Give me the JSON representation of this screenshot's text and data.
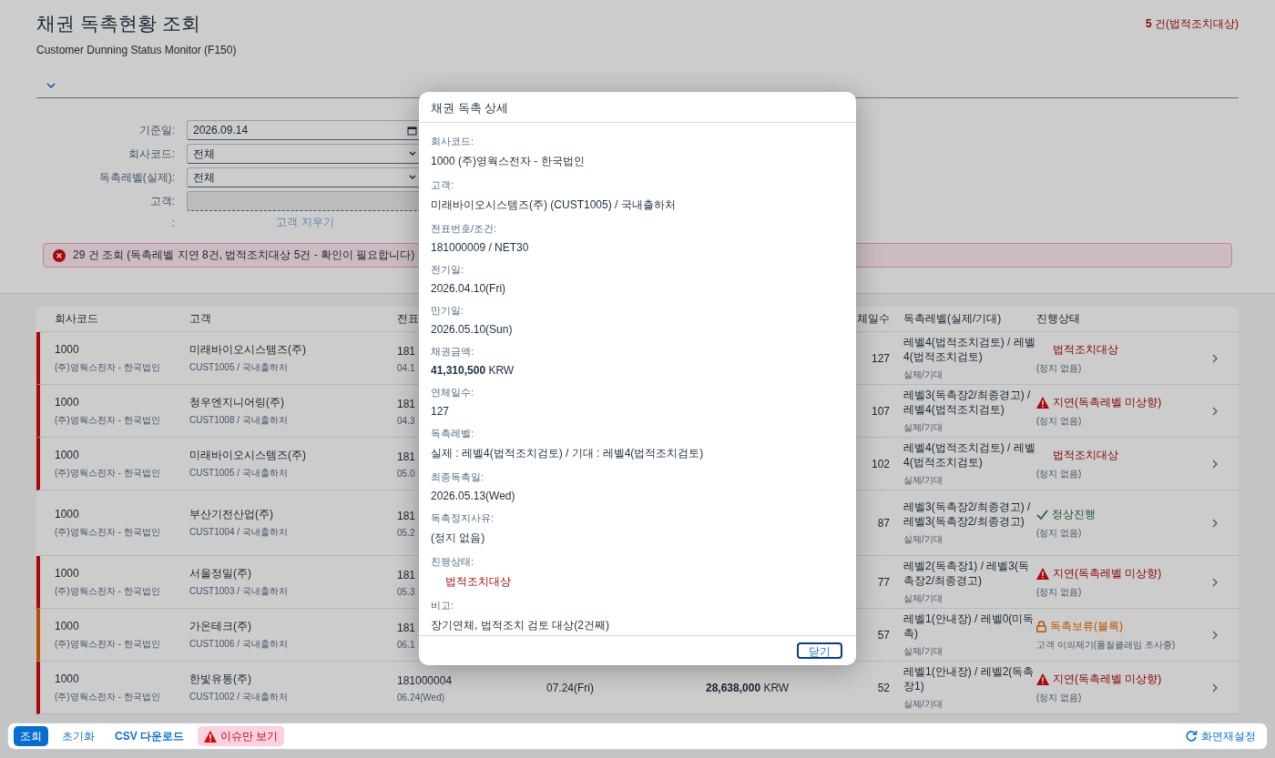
{
  "page": {
    "title": "채권 독촉현황 조회",
    "subtitle": "Customer Dunning Status Monitor (F150)",
    "legal_count": "**5** 건(법적조치대상)"
  },
  "filters": [
    {
      "label": "기준일:",
      "kind": "date",
      "value": "2026.09.14"
    },
    {
      "label": "회사코드:",
      "kind": "select",
      "value": "전체"
    },
    {
      "label": "독촉레벨(실제):",
      "kind": "select",
      "value": "전체"
    },
    {
      "label": "고객:",
      "kind": "text",
      "disabled": true
    },
    {
      "label": ":",
      "kind": "link",
      "value": "고객 지우기"
    }
  ],
  "message": {
    "text": "29 건 조회 (독촉레벨 지연 8건, 법적조치대상 5건 - 확인이 필요합니다)"
  },
  "table": {
    "headers": {
      "company": "회사코드",
      "customer": "고객",
      "document": "전표",
      "days": "체일수",
      "level": "독촉레벨(실제/기대)",
      "status": "진행상태"
    },
    "rows": [
      {
        "kind": "legal",
        "company": "1000",
        "company_name": "(주)영웍스전자 - 한국법인",
        "customer": "미래바이오시스템즈(주)",
        "customer_sub": "CUST1005 / 국내출하처",
        "document": "181",
        "doc_date": "04.1",
        "days": "127",
        "level": "레벨4(법적조치검토) / 레벨4(법적조치검토)",
        "level_sub": "실제/기대",
        "status": "법적조치대상",
        "status_note": "(정지 없음)"
      },
      {
        "kind": "delay",
        "company": "1000",
        "company_name": "(주)영웍스전자 - 한국법인",
        "customer": "청우엔지니어링(주)",
        "customer_sub": "CUST1008 / 국내출하처",
        "document": "181",
        "doc_date": "04.3",
        "days": "107",
        "level": "레벨3(독촉장2/최종경고) / 레벨4(법적조치검토)",
        "level_sub": "실제/기대",
        "status": "지연(독촉레벨 미상향)",
        "status_note": "(정지 없음)"
      },
      {
        "kind": "legal",
        "company": "1000",
        "company_name": "(주)영웍스전자 - 한국법인",
        "customer": "미래바이오시스템즈(주)",
        "customer_sub": "CUST1005 / 국내출하처",
        "document": "181",
        "doc_date": "05.0",
        "days": "102",
        "level": "레벨4(법적조치검토) / 레벨4(법적조치검토)",
        "level_sub": "실제/기대",
        "status": "법적조치대상",
        "status_note": "(정지 없음)"
      },
      {
        "kind": "normal",
        "company": "1000",
        "company_name": "(주)영웍스전자 - 한국법인",
        "customer": "부산기전산업(주)",
        "customer_sub": "CUST1004 / 국내출하처",
        "document": "181",
        "doc_date": "05.2",
        "days": "87",
        "level": "레벨3(독촉장2/최종경고) / 레벨3(독촉장2/최종경고)",
        "level_sub": "실제/기대",
        "status": "정상진행",
        "status_note": "(정지 없음)"
      },
      {
        "kind": "delay",
        "company": "1000",
        "company_name": "(주)영웍스전자 - 한국법인",
        "customer": "서울정밀(주)",
        "customer_sub": "CUST1003 / 국내출하처",
        "document": "181",
        "doc_date": "05.3",
        "days": "77",
        "level": "레벨2(독촉장1) / 레벨3(독촉장2/최종경고)",
        "level_sub": "실제/기대",
        "status": "지연(독촉레벨 미상향)",
        "status_note": "(정지 없음)"
      },
      {
        "kind": "hold",
        "company": "1000",
        "company_name": "(주)영웍스전자 - 한국법인",
        "customer": "가온테크(주)",
        "customer_sub": "CUST1006 / 국내출하처",
        "document": "181",
        "doc_date": "06.1",
        "days": "57",
        "level": "레벨1(안내장) / 레벨0(미독촉)",
        "level_sub": "실제/기대",
        "status": "독촉보류(블록)",
        "status_note": "고객 이의제기(품질클레임 조사중)"
      },
      {
        "kind": "delay",
        "company": "1000",
        "company_name": "(주)영웍스전자 - 한국법인",
        "customer": "한빛유통(주)",
        "customer_sub": "CUST1002 / 국내출하처",
        "document": "181000004",
        "doc_date": "06.24(Wed)",
        "due": "07.24(Fri)",
        "amount": "**28,638,000** KRW",
        "days": "52",
        "level": "레벨1(안내장) / 레벨2(독촉장1)",
        "level_sub": "실제/기대",
        "status": "지연(독촉레벨 미상향)",
        "status_note": "(정지 없음)"
      }
    ]
  },
  "actions": [
    {
      "kind": "primary",
      "label": "조회"
    },
    {
      "kind": "plain",
      "label": "초기화"
    },
    {
      "kind": "bold",
      "label": "CSV 다운로드"
    },
    {
      "kind": "toggle",
      "label": "이슈만 보기",
      "on": true
    }
  ],
  "reset_label": "화면재설정",
  "dialog": {
    "title": "채권 독촉 상세",
    "close": "닫기",
    "fields": [
      {
        "kind": "text",
        "label": "회사코드:",
        "value": "1000 (주)영웍스전자 - 한국법인"
      },
      {
        "kind": "text",
        "label": "고객:",
        "value": "미래바이오시스템즈(주) (CUST1005) / 국내출하처"
      },
      {
        "kind": "text",
        "label": "전표번호/조건:",
        "value": "181000009 / NET30"
      },
      {
        "kind": "text",
        "label": "전기일:",
        "value": "2026.04.10(Fri)"
      },
      {
        "kind": "text",
        "label": "만기일:",
        "value": "2026.05.10(Sun)"
      },
      {
        "kind": "amount",
        "label": "채권금액:",
        "value": "**41,310,500** KRW"
      },
      {
        "kind": "text",
        "label": "연체일수:",
        "value": "127"
      },
      {
        "kind": "text",
        "label": "독촉레벨:",
        "value": "실제 : 레벨4(법적조치검토) / 기대 : 레벨4(법적조치검토)"
      },
      {
        "kind": "text",
        "label": "최종독촉일:",
        "value": "2026.05.13(Wed)"
      },
      {
        "kind": "text",
        "label": "독촉정지사유:",
        "value": "(정지 없음)"
      },
      {
        "kind": "status",
        "label": "진행상태:",
        "value": "법적조치대상"
      },
      {
        "kind": "text",
        "label": "비고:",
        "value": "장기연체, 법적조치 검토 대상(2건째)"
      }
    ]
  }
}
